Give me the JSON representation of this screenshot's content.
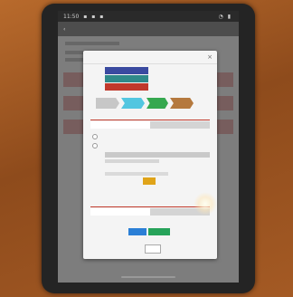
{
  "statusbar": {
    "time": "11:50",
    "icons_left": [
      "notification-icon",
      "notification-icon",
      "notification-icon"
    ],
    "icons_right": [
      "wifi-icon",
      "battery-icon"
    ]
  },
  "modal": {
    "close_label": "×",
    "buttons_left": [
      {
        "name": "modal-btn-1",
        "color": "#3a4aa0"
      },
      {
        "name": "modal-btn-2",
        "color": "#2f8a8a"
      },
      {
        "name": "modal-btn-3",
        "color": "#c0392b"
      }
    ],
    "flow_colors": [
      "#c7c7c7",
      "#53c6e0",
      "#35a84f",
      "#b5793e"
    ],
    "section1_accent": "#c0392b",
    "submit_color": "#e0a419",
    "section2_accent": "#c0392b",
    "bottom_btn_1_color": "#2b7fd6",
    "bottom_btn_2_color": "#27a35a"
  }
}
